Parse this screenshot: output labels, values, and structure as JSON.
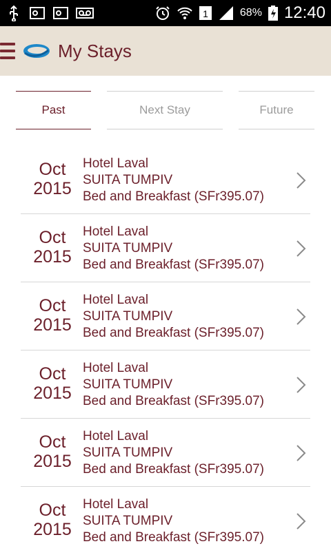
{
  "status_bar": {
    "battery_text": "68%",
    "time": "12:40",
    "sim_number": "1",
    "icons": [
      "usb-icon",
      "outlook-icon",
      "outlook-icon",
      "voicemail-icon",
      "alarm-icon",
      "wifi-icon",
      "signal-icon",
      "battery-charging-icon"
    ]
  },
  "app_bar": {
    "title": "My Stays",
    "icons": [
      "menu-icon",
      "app-logo-icon"
    ]
  },
  "tabs": [
    {
      "label": "Past",
      "active": true
    },
    {
      "label": "Next Stay",
      "active": false
    },
    {
      "label": "Future",
      "active": false
    }
  ],
  "stays": [
    {
      "month": "Oct",
      "year": "2015",
      "hotel": "Hotel Laval",
      "room": "SUITA TUMPIV",
      "rate": "Bed and Breakfast (SFr395.07)"
    },
    {
      "month": "Oct",
      "year": "2015",
      "hotel": "Hotel Laval",
      "room": "SUITA TUMPIV",
      "rate": "Bed and Breakfast (SFr395.07)"
    },
    {
      "month": "Oct",
      "year": "2015",
      "hotel": "Hotel Laval",
      "room": "SUITA TUMPIV",
      "rate": "Bed and Breakfast (SFr395.07)"
    },
    {
      "month": "Oct",
      "year": "2015",
      "hotel": "Hotel Laval",
      "room": "SUITA TUMPIV",
      "rate": "Bed and Breakfast (SFr395.07)"
    },
    {
      "month": "Oct",
      "year": "2015",
      "hotel": "Hotel Laval",
      "room": "SUITA TUMPIV",
      "rate": "Bed and Breakfast (SFr395.07)"
    },
    {
      "month": "Oct",
      "year": "2015",
      "hotel": "Hotel Laval",
      "room": "SUITA TUMPIV",
      "rate": "Bed and Breakfast (SFr395.07)"
    }
  ],
  "colors": {
    "accent": "#6b1f2a",
    "app_bar_bg": "#e9e1d5",
    "inactive_tab": "#9b9b9b",
    "divider": "#d6d6d6"
  }
}
